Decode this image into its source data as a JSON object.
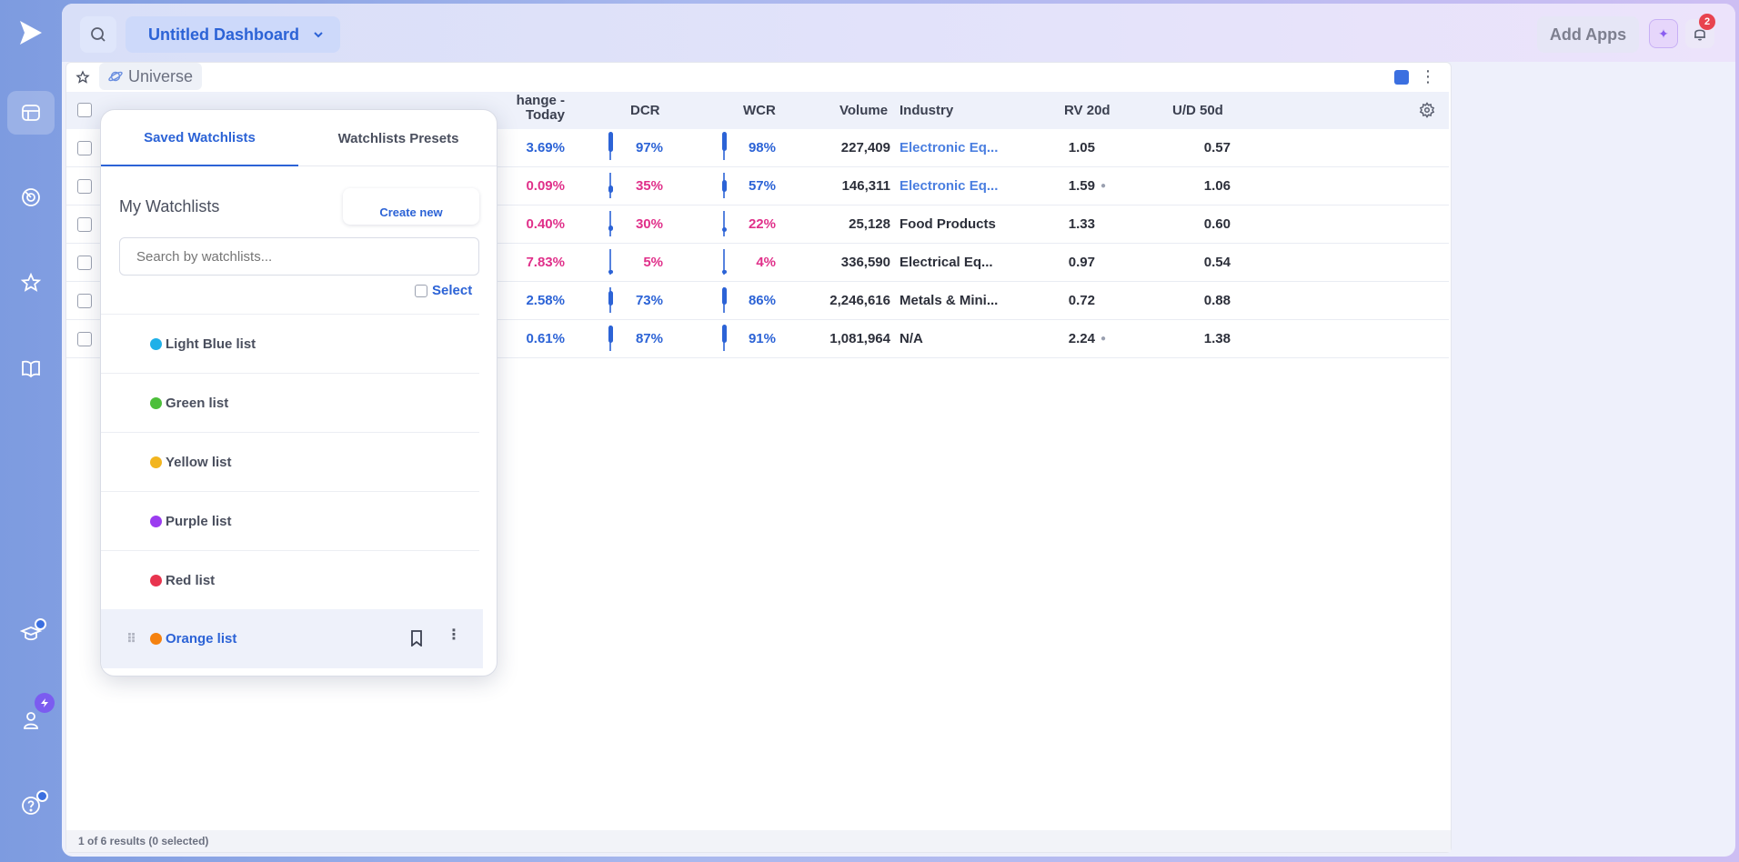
{
  "topbar": {
    "dashboard_title": "Untitled Dashboard",
    "add_apps_label": "Add Apps",
    "notification_count": "2"
  },
  "widget": {
    "universe_label": "Universe",
    "footer_text": "1 of 6 results (0 selected)"
  },
  "table": {
    "headers": {
      "change_line1": "hange -",
      "change_line2": "Today",
      "dcr": "DCR",
      "wcr": "WCR",
      "volume": "Volume",
      "industry": "Industry",
      "rv20d": "RV 20d",
      "ud50d": "U/D 50d"
    },
    "rows": [
      {
        "change": "3.69%",
        "dcr": "97%",
        "wcr": "98%",
        "volume": "227,409",
        "industry": "Electronic Eq...",
        "rv": "1.05",
        "ud": "0.57"
      },
      {
        "change": "0.09%",
        "dcr": "35%",
        "wcr": "57%",
        "volume": "146,311",
        "industry": "Electronic Eq...",
        "rv": "1.59",
        "ud": "1.06"
      },
      {
        "change": "0.40%",
        "dcr": "30%",
        "wcr": "22%",
        "volume": "25,128",
        "industry": "Food Products",
        "rv": "1.33",
        "ud": "0.60"
      },
      {
        "change": "7.83%",
        "dcr": "5%",
        "wcr": "4%",
        "volume": "336,590",
        "industry": "Electrical Eq...",
        "rv": "0.97",
        "ud": "0.54"
      },
      {
        "change": "2.58%",
        "dcr": "73%",
        "wcr": "86%",
        "volume": "2,246,616",
        "industry": "Metals & Mini...",
        "rv": "0.72",
        "ud": "0.88"
      },
      {
        "change": "0.61%",
        "dcr": "87%",
        "wcr": "91%",
        "volume": "1,081,964",
        "industry": "N/A",
        "rv": "2.24",
        "ud": "1.38"
      }
    ]
  },
  "popover": {
    "tab_saved": "Saved Watchlists",
    "tab_presets": "Watchlists Presets",
    "my_watchlists": "My Watchlists",
    "create_new": "Create new",
    "search_placeholder": "Search by watchlists...",
    "select_label": "Select",
    "items": [
      {
        "label": "Light Blue list",
        "color": "#1fb0e8"
      },
      {
        "label": "Green list",
        "color": "#4cbf3a"
      },
      {
        "label": "Yellow list",
        "color": "#f2b51f"
      },
      {
        "label": "Purple list",
        "color": "#9b3cf0"
      },
      {
        "label": "Red list",
        "color": "#e8344e"
      },
      {
        "label": "Orange list",
        "color": "#f5820f"
      }
    ]
  }
}
